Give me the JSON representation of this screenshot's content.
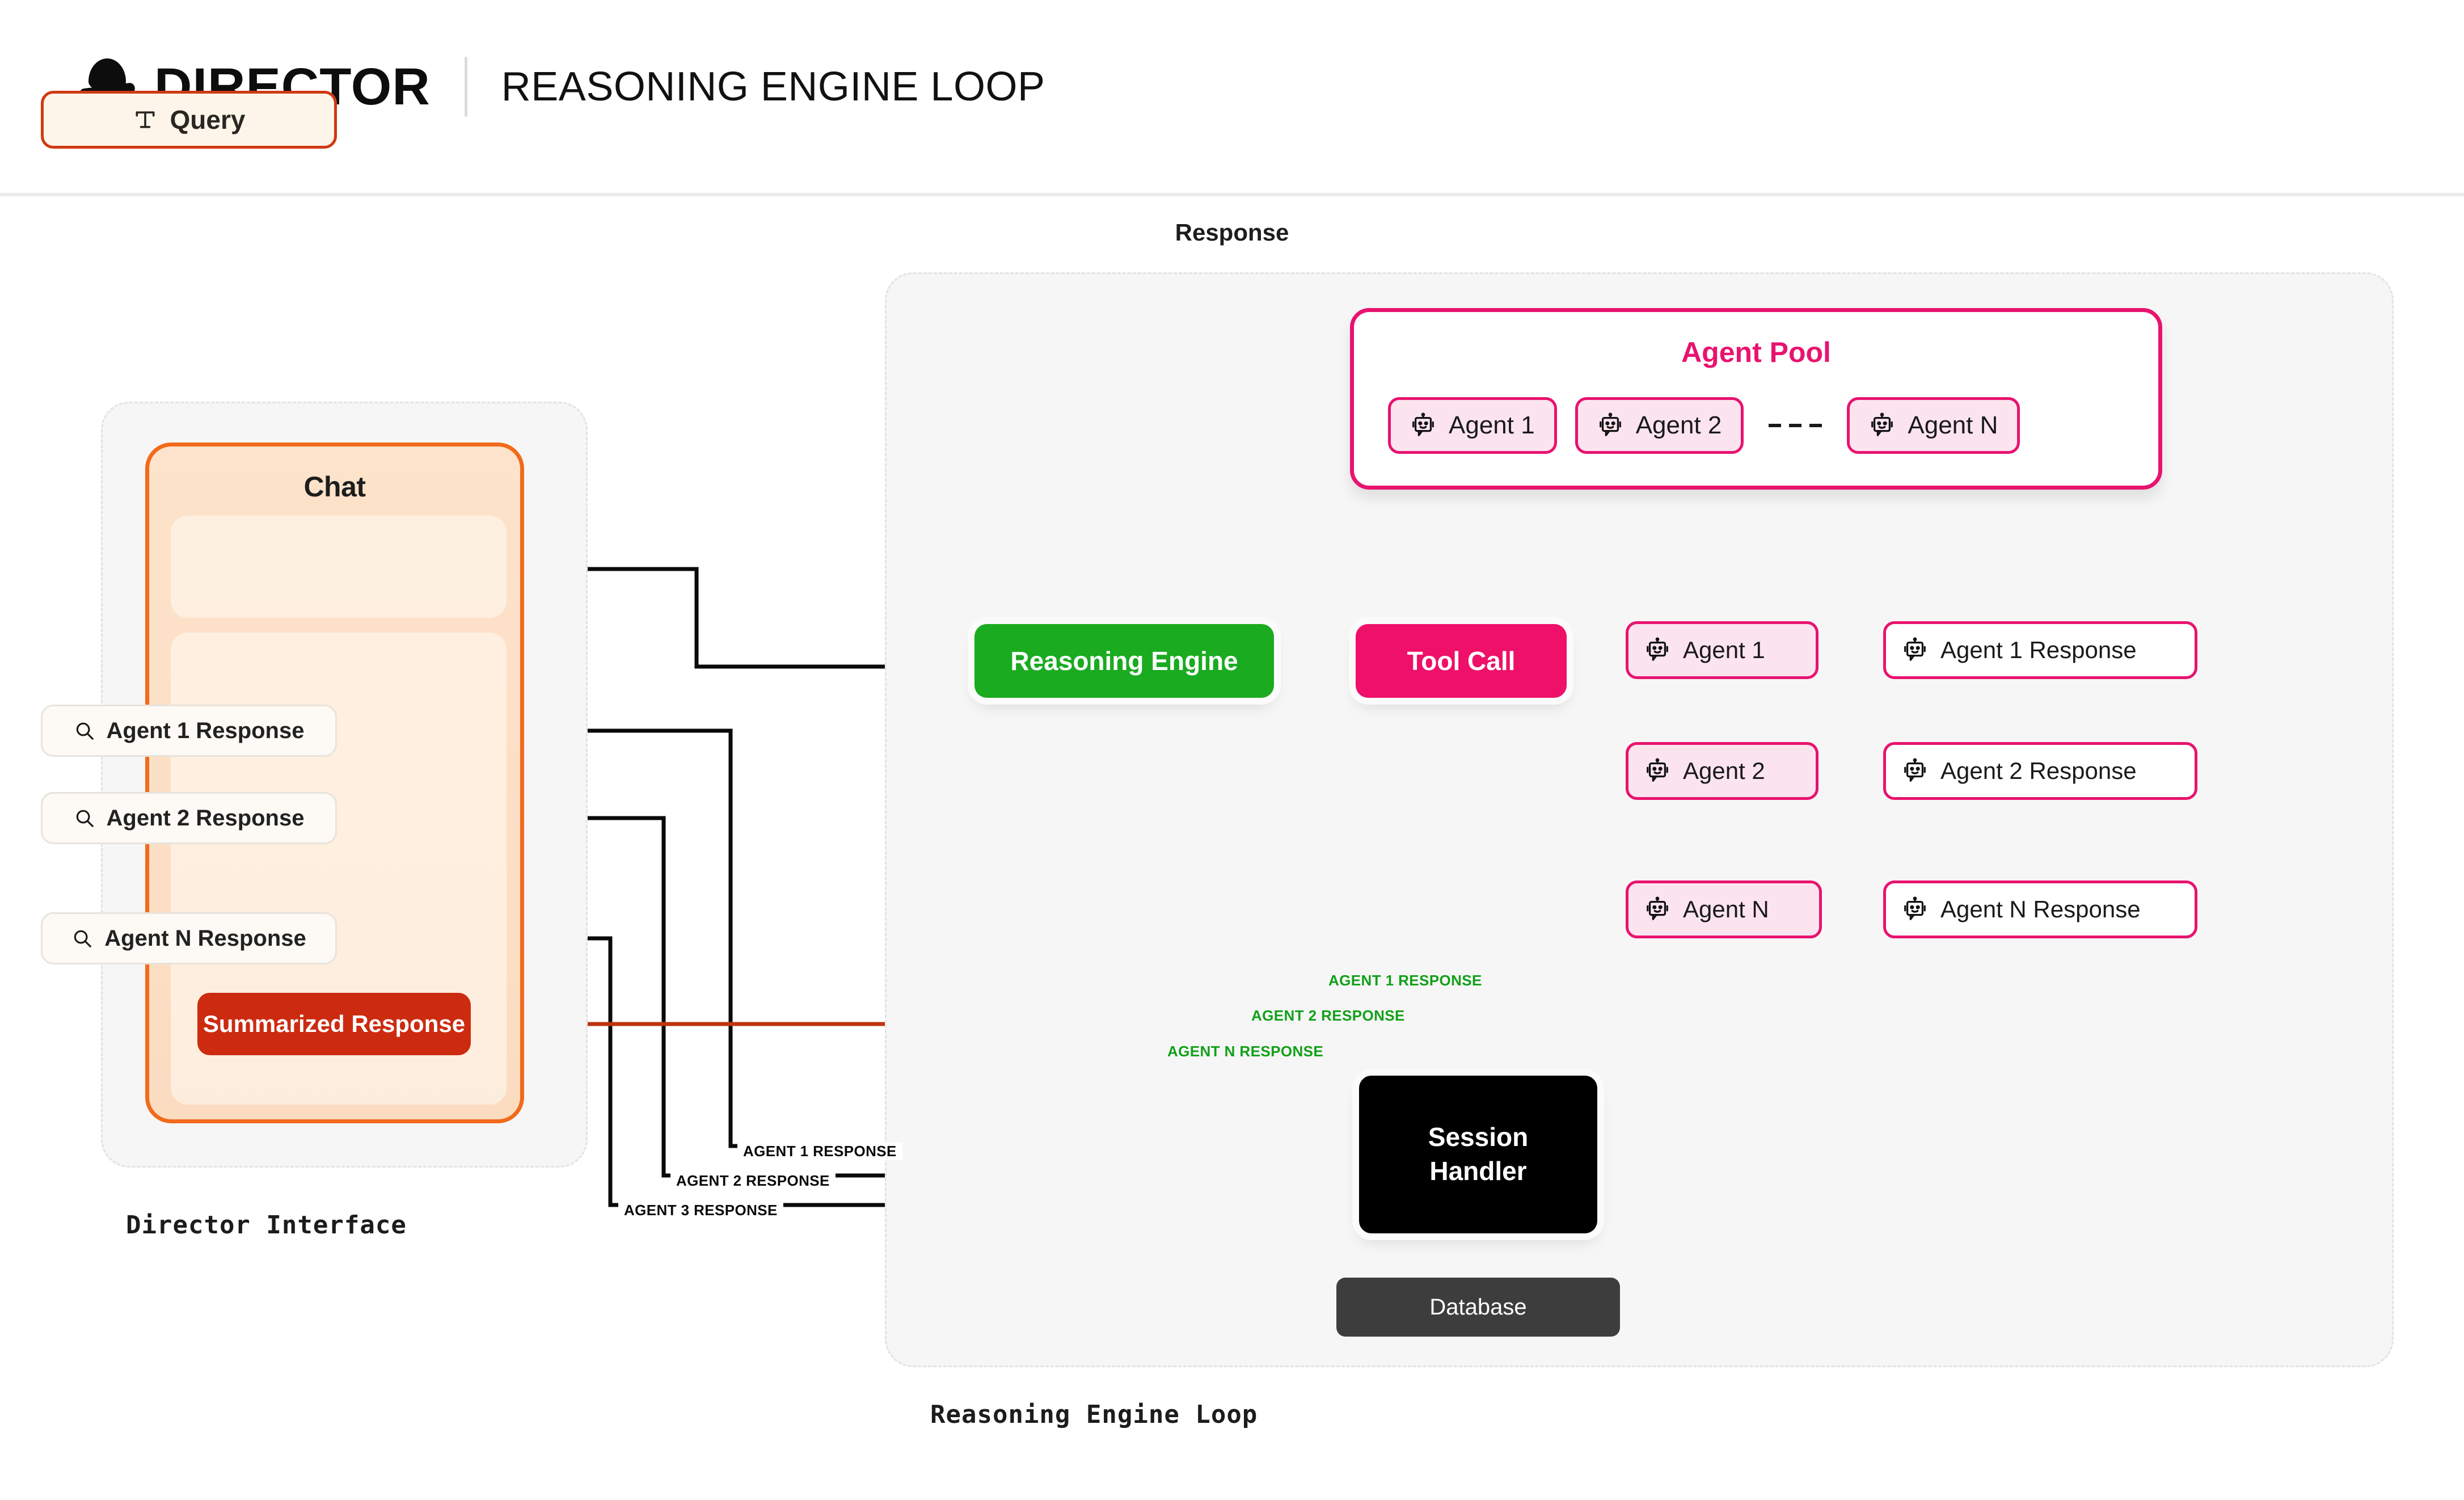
{
  "header": {
    "brand": "DIRECTOR",
    "title": "REASONING ENGINE LOOP",
    "logo_icon": "director-hat-logo"
  },
  "colors": {
    "brand_orange": "#ef6a20",
    "chat_border": "#f26a1b",
    "summary_red": "#cc2b10",
    "pink": "#e8136f",
    "tool_call_pink": "#ee1069",
    "green": "#1aab20",
    "edge_green": "#12a018",
    "session_black": "#000000",
    "database_gray": "#3d3d3d",
    "panel_bg": "#f6f6f6"
  },
  "director_panel": {
    "caption": "Director Interface",
    "chat": {
      "title": "Chat",
      "query": {
        "label": "Query",
        "icon": "text-t-icon"
      },
      "response_section_title": "Response",
      "ellipsis": "⋮",
      "responses": [
        {
          "label": "Agent 1 Response",
          "icon": "search-icon"
        },
        {
          "label": "Agent 2 Response",
          "icon": "search-icon"
        },
        {
          "label": "Agent N Response",
          "icon": "search-icon"
        }
      ],
      "summary": {
        "label": "Summarized Response"
      }
    }
  },
  "loop_panel": {
    "caption": "Reasoning Engine Loop",
    "agent_pool": {
      "title": "Agent Pool",
      "agents": [
        {
          "label": "Agent 1",
          "icon": "robot-icon"
        },
        {
          "label": "Agent 2",
          "icon": "robot-icon"
        },
        {
          "label": "Agent N",
          "icon": "robot-icon"
        }
      ],
      "separator": "dashed-link"
    },
    "nodes": {
      "reasoning_engine": "Reasoning Engine",
      "tool_call": "Tool Call",
      "session_handler_line1": "Session",
      "session_handler_line2": "Handler",
      "database": "Database"
    },
    "agents": [
      {
        "label": "Agent 1",
        "icon": "robot-icon"
      },
      {
        "label": "Agent 2",
        "icon": "robot-icon"
      },
      {
        "label": "Agent N",
        "icon": "robot-icon"
      }
    ],
    "agent_responses": [
      {
        "label": "Agent 1 Response",
        "icon": "robot-icon"
      },
      {
        "label": "Agent 2 Response",
        "icon": "robot-icon"
      },
      {
        "label": "Agent N Response",
        "icon": "robot-icon"
      }
    ],
    "green_edge_labels": [
      "AGENT 1 RESPONSE",
      "AGENT 2 RESPONSE",
      "AGENT N RESPONSE"
    ],
    "black_edge_labels": [
      "AGENT 1 RESPONSE",
      "AGENT 2 RESPONSE",
      "AGENT 3 RESPONSE"
    ]
  }
}
